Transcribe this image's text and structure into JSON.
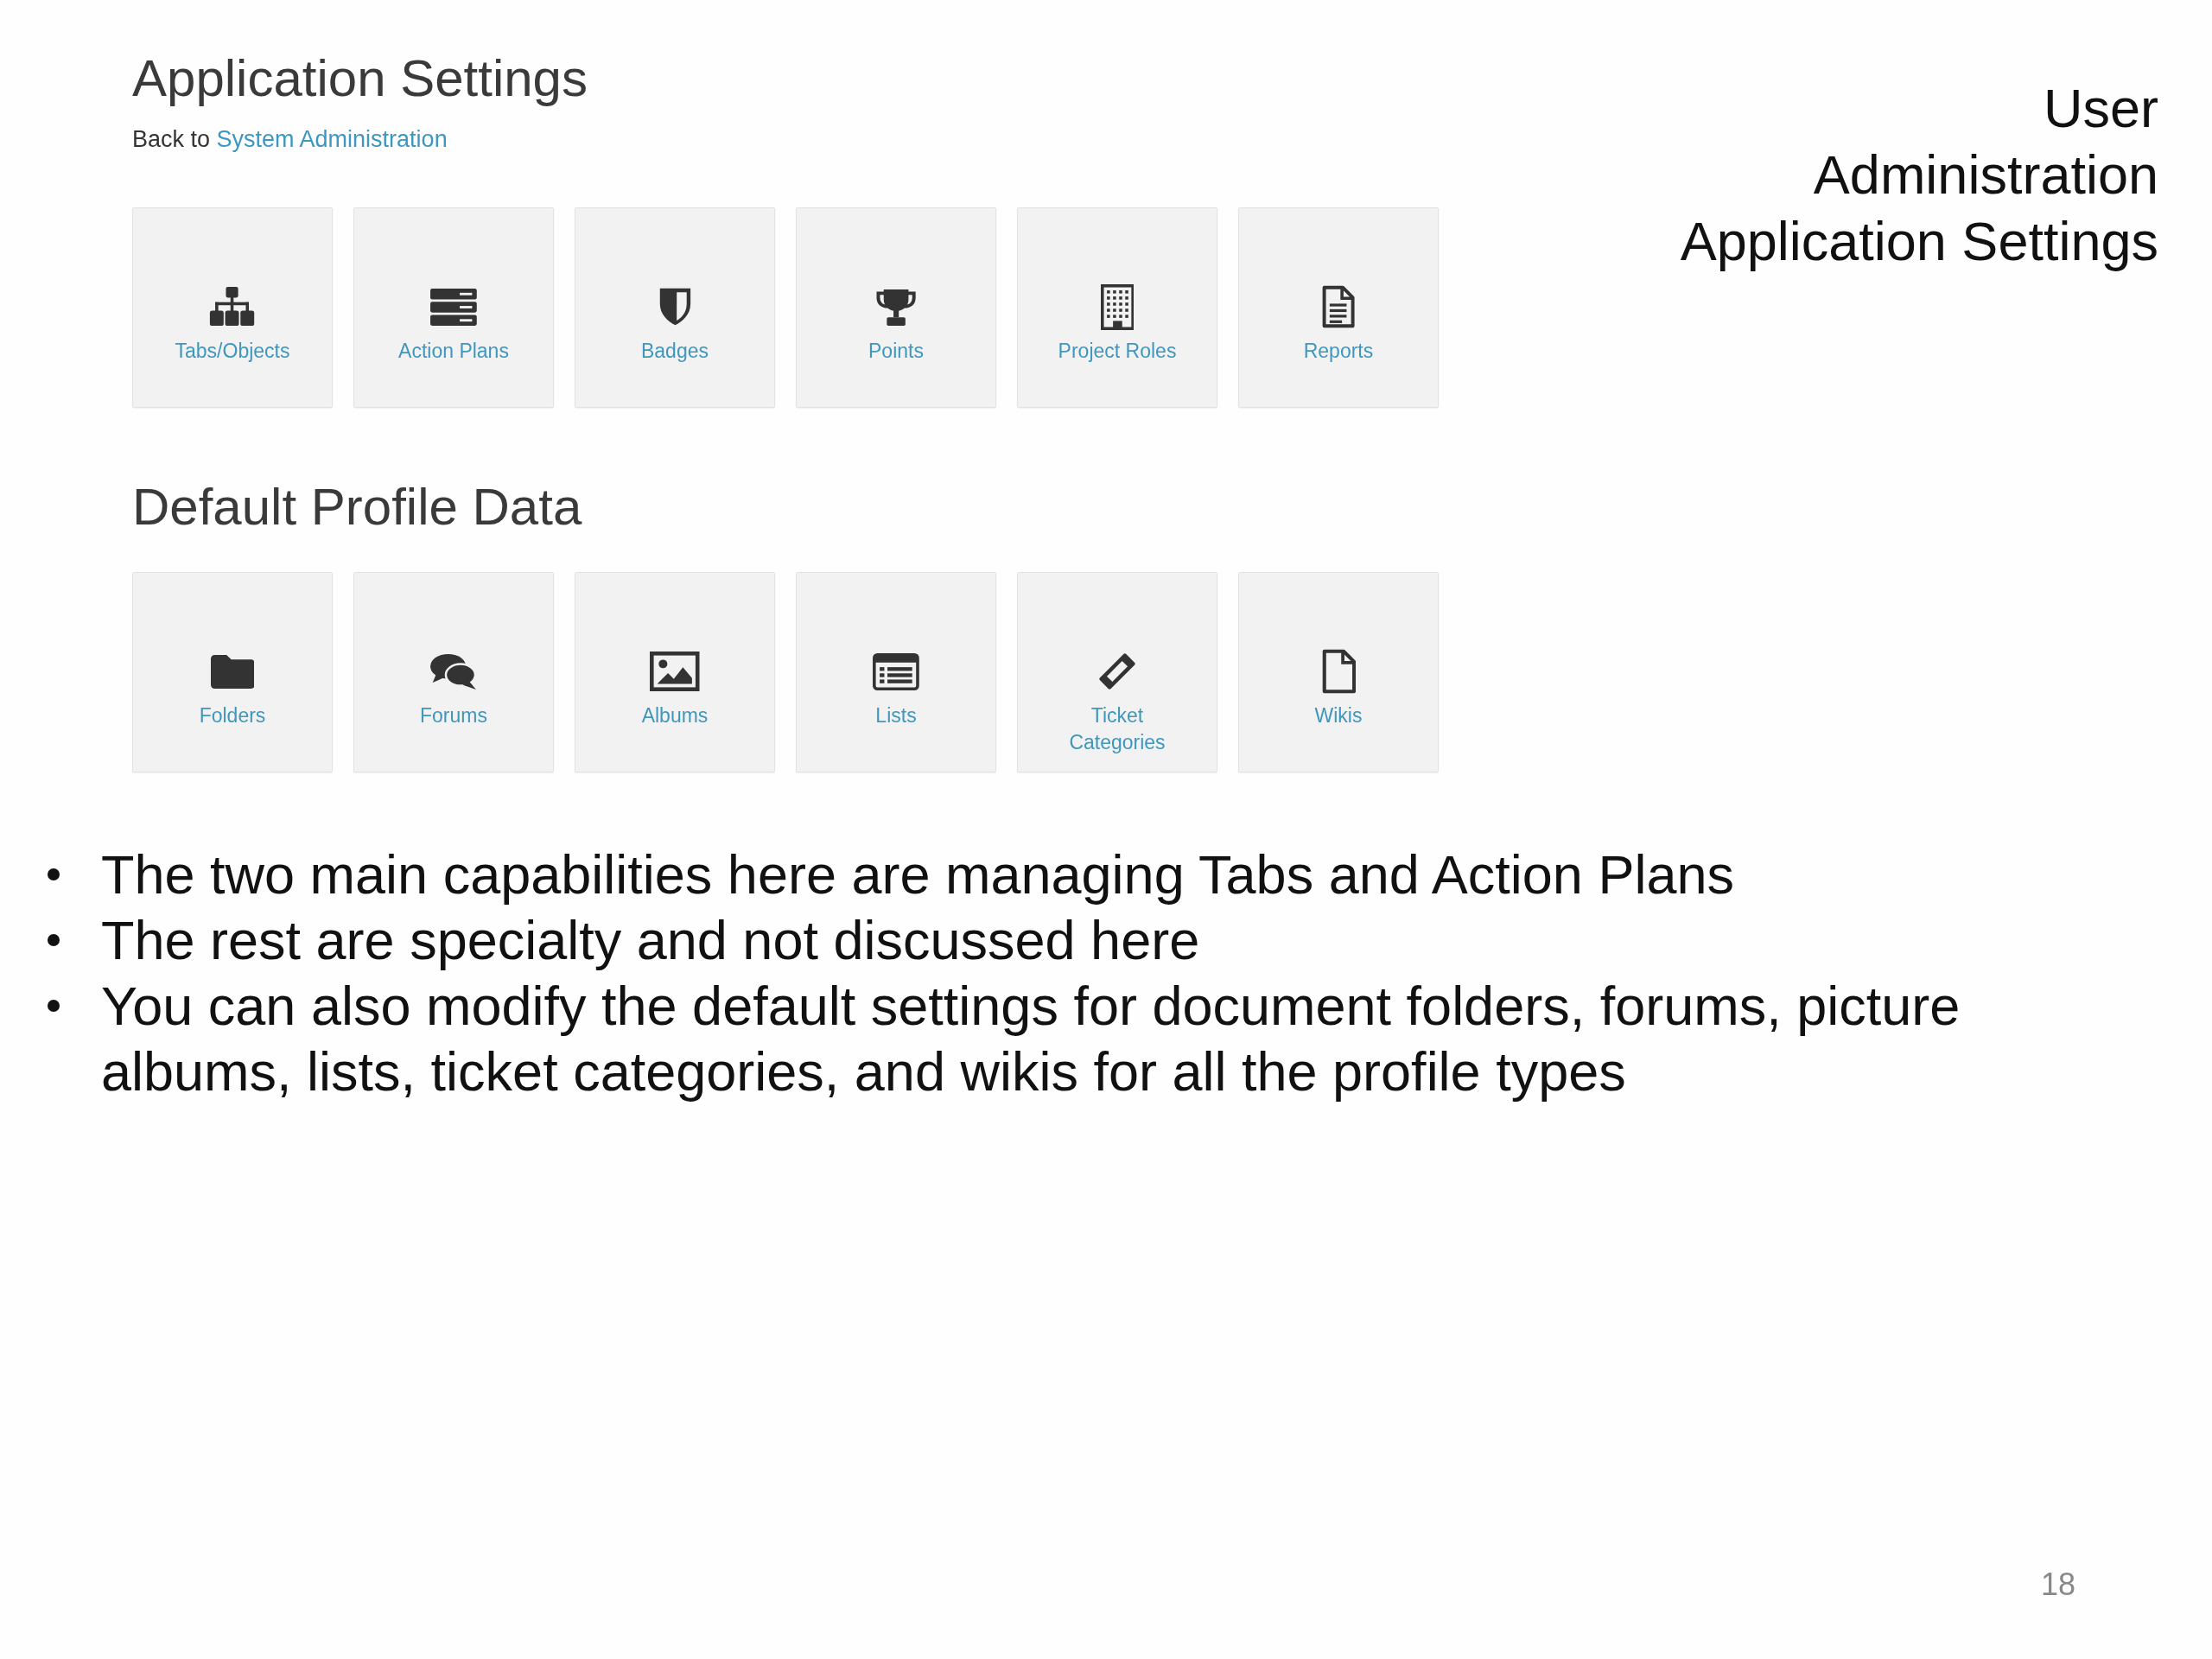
{
  "settings_page": {
    "title": "Application Settings",
    "back_prefix": "Back to",
    "back_link": "System Administration",
    "tiles": [
      {
        "label": "Tabs/Objects",
        "kind": "sitemap"
      },
      {
        "label": "Action Plans",
        "kind": "server"
      },
      {
        "label": "Badges",
        "kind": "shield"
      },
      {
        "label": "Points",
        "kind": "trophy"
      },
      {
        "label": "Project Roles",
        "kind": "building"
      },
      {
        "label": "Reports",
        "kind": "document"
      }
    ],
    "default_profile_data": {
      "heading": "Default Profile Data",
      "tiles": [
        {
          "label": "Folders",
          "kind": "folder"
        },
        {
          "label": "Forums",
          "kind": "bubbles"
        },
        {
          "label": "Albums",
          "kind": "picture"
        },
        {
          "label": "Lists",
          "kind": "list"
        },
        {
          "label": "Ticket Categories",
          "kind": "ticket"
        },
        {
          "label": "Wikis",
          "kind": "page"
        }
      ]
    }
  },
  "slide_title_lines": [
    "User",
    "Administration",
    "Application Settings"
  ],
  "bullets": [
    "The two main capabilities here are managing Tabs and Action Plans",
    "The rest are specialty and not discussed here",
    "You can also modify the default settings for document folders, forums, picture albums, lists, ticket categories, and wikis for all the profile types"
  ],
  "page_number": "18"
}
